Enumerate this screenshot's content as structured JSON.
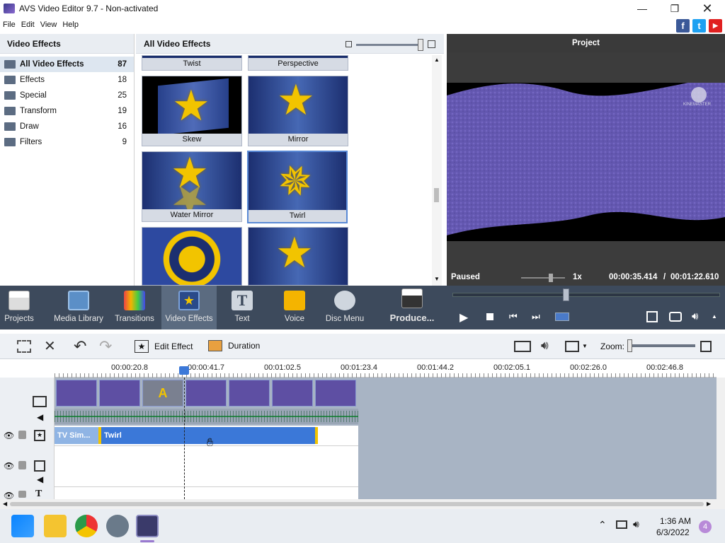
{
  "window": {
    "title": "AVS Video Editor 9.7 - Non-activated"
  },
  "menu": [
    "File",
    "Edit",
    "View",
    "Help"
  ],
  "social": {
    "facebook": "f",
    "twitter": "t",
    "youtube": "▶"
  },
  "left_panel": {
    "title": "Video Effects",
    "categories": [
      {
        "name": "All Video Effects",
        "count": "87"
      },
      {
        "name": "Effects",
        "count": "18"
      },
      {
        "name": "Special",
        "count": "25"
      },
      {
        "name": "Transform",
        "count": "19"
      },
      {
        "name": "Draw",
        "count": "16"
      },
      {
        "name": "Filters",
        "count": "9"
      }
    ]
  },
  "grid": {
    "title": "All Video Effects",
    "tiles": [
      "Twist",
      "Perspective",
      "Skew",
      "Mirror",
      "Water Mirror",
      "Twirl"
    ]
  },
  "preview": {
    "title": "Project",
    "status": "Paused",
    "speed": "1x",
    "time_current": "00:00:35.414",
    "time_sep": "/",
    "time_total": "00:01:22.610",
    "watermark": "KINEMASTER"
  },
  "toolbar": {
    "projects": "Projects",
    "media": "Media Library",
    "transitions": "Transitions",
    "effects": "Video Effects",
    "text": "Text",
    "voice": "Voice",
    "disc": "Disc Menu",
    "produce": "Produce..."
  },
  "timeline_toolbar": {
    "edit_effect": "Edit Effect",
    "duration": "Duration",
    "zoom": "Zoom:"
  },
  "ruler": [
    "00:00:20.8",
    "00:00:41.7",
    "00:01:02.5",
    "00:01:23.4",
    "00:01:44.2",
    "00:02:05.1",
    "00:02:26.0",
    "00:02:46.8"
  ],
  "effect_track": {
    "clip1": "TV Sim...",
    "clip2": "Twirl"
  },
  "taskbar": {
    "time": "1:36 AM",
    "date": "6/3/2022",
    "badge": "4"
  },
  "colors": {
    "toolbar": "#3d4a5c",
    "effect_clip": "#3b78d8",
    "accent": "#5a8ad6"
  }
}
